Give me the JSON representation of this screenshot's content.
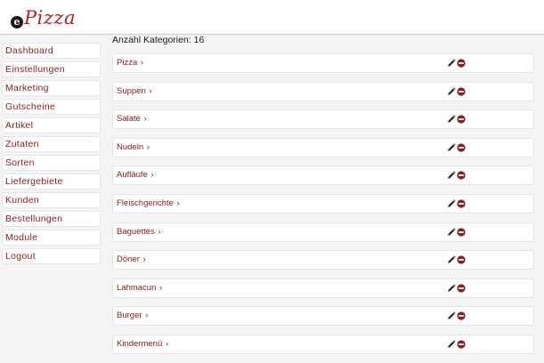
{
  "app": {
    "logo_letter": "e",
    "logo_name": "Pizza",
    "brand_color": "#b5222a"
  },
  "sidebar": {
    "items": [
      {
        "label": "Dashboard"
      },
      {
        "label": "Einstellungen"
      },
      {
        "label": "Marketing"
      },
      {
        "label": "Gutscheine"
      },
      {
        "label": "Artikel"
      },
      {
        "label": "Zutaten"
      },
      {
        "label": "Sorten"
      },
      {
        "label": "Liefergebiete"
      },
      {
        "label": "Kunden"
      },
      {
        "label": "Bestellungen"
      },
      {
        "label": "Module"
      },
      {
        "label": "Logout"
      }
    ]
  },
  "main": {
    "count_text": "Anzahl Kategorien: 16",
    "categories": [
      {
        "name": "Pizza"
      },
      {
        "name": "Suppen"
      },
      {
        "name": "Salate"
      },
      {
        "name": "Nudeln"
      },
      {
        "name": "Aufläufe"
      },
      {
        "name": "Fleischgerichte"
      },
      {
        "name": "Baguettes"
      },
      {
        "name": "Döner"
      },
      {
        "name": "Lahmacun"
      },
      {
        "name": "Burger"
      },
      {
        "name": "Kindermenü"
      }
    ],
    "chevron": "›",
    "row_actions": {
      "edit_icon": "pencil-icon",
      "delete_icon": "minus-circle-icon"
    }
  }
}
